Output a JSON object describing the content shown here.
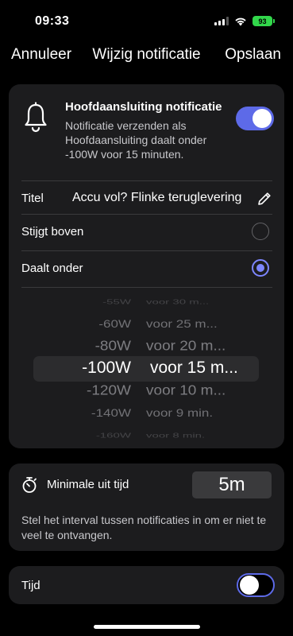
{
  "status_bar": {
    "time": "09:33",
    "battery": "93"
  },
  "nav": {
    "cancel": "Annuleer",
    "title": "Wijzig notificatie",
    "save": "Opslaan"
  },
  "notification": {
    "title": "Hoofdaansluiting notificatie",
    "description": "Notificatie verzenden als Hoofdaansluiting daalt onder -100W voor 15 minuten.",
    "enabled": true,
    "icon": "bell-icon"
  },
  "title_field": {
    "label": "Titel",
    "value": "Accu vol? Flinke teruglevering",
    "icon": "pencil-icon"
  },
  "conditions": {
    "above": {
      "label": "Stijgt boven",
      "selected": false
    },
    "below": {
      "label": "Daalt onder",
      "selected": true
    }
  },
  "picker": {
    "items": [
      {
        "watt": "-55W",
        "time": "voor 30 m..."
      },
      {
        "watt": "-60W",
        "time": "voor 25 m..."
      },
      {
        "watt": "-80W",
        "time": "voor 20 m..."
      },
      {
        "watt": "-100W",
        "time": "voor 15 m..."
      },
      {
        "watt": "-120W",
        "time": "voor 10 m..."
      },
      {
        "watt": "-140W",
        "time": "voor 9 min."
      },
      {
        "watt": "-160W",
        "time": "voor 8 min."
      }
    ],
    "selected_index": 3
  },
  "min_off_time": {
    "label": "Minimale uit tijd",
    "value": "5m",
    "description": "Stel het interval tussen notificaties in om er niet te veel te ontvangen.",
    "icon": "timer-icon"
  },
  "time_option": {
    "label": "Tijd",
    "enabled": false
  },
  "colors": {
    "accent": "#5d6ae8",
    "card": "#1c1c1e",
    "background": "#000000"
  }
}
